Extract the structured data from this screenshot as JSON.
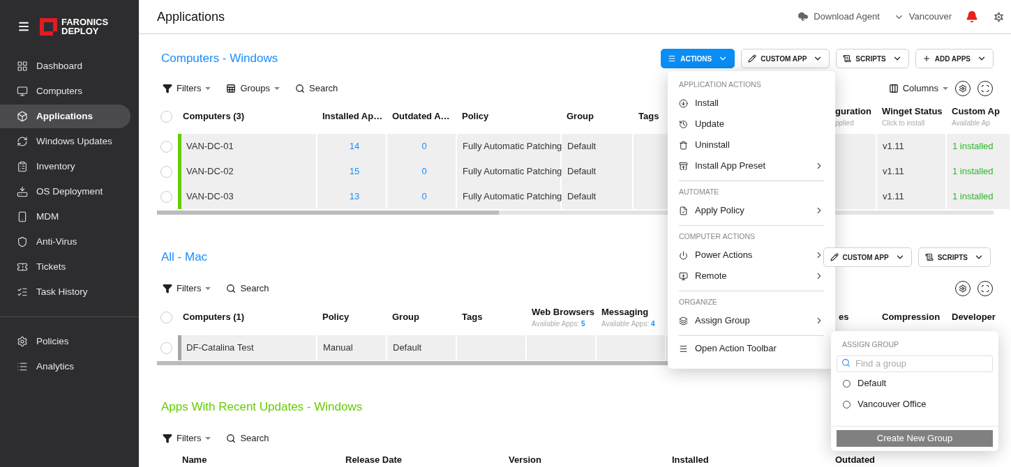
{
  "sidebar": {
    "brand": [
      "FARONICS",
      "DEPLOY"
    ],
    "items": [
      {
        "label": "Dashboard",
        "selected": false
      },
      {
        "label": "Computers",
        "selected": false
      },
      {
        "label": "Applications",
        "selected": true
      },
      {
        "label": "Windows Updates",
        "selected": false
      },
      {
        "label": "Inventory",
        "selected": false
      },
      {
        "label": "OS Deployment",
        "selected": false
      },
      {
        "label": "MDM",
        "selected": false
      },
      {
        "label": "Anti-Virus",
        "selected": false
      },
      {
        "label": "Tickets",
        "selected": false
      },
      {
        "label": "Task History",
        "selected": false
      }
    ],
    "secondary_items": [
      {
        "label": "Policies",
        "selected": false
      },
      {
        "label": "Analytics",
        "selected": false
      }
    ]
  },
  "header": {
    "title": "Applications",
    "download": "Download Agent",
    "location": "Vancouver"
  },
  "windows_section": {
    "title": "Computers - Windows",
    "buttons": [
      {
        "label": "ACTIONS",
        "selected": true
      },
      {
        "label": "CUSTOM APP",
        "selected": false
      },
      {
        "label": "SCRIPTS",
        "selected": false
      },
      {
        "label": "ADD APPS",
        "selected": false
      }
    ],
    "toolbar": {
      "filters": "Filters",
      "groups": "Groups",
      "search": "Search",
      "columns": "Columns"
    },
    "header_checked": false,
    "columns": [
      {
        "label": "Computers (3)"
      },
      {
        "label": "Installed Ap…"
      },
      {
        "label": "Outdated A…"
      },
      {
        "label": "Policy"
      },
      {
        "label": "Group"
      },
      {
        "label": "Tags"
      },
      {
        "label": "guration",
        "subtitle": "pplied"
      },
      {
        "label": "Winget Status",
        "subtitle": "Click to install"
      },
      {
        "label": "Custom Ap",
        "subtitle": "Available Ap"
      }
    ],
    "rows": [
      {
        "name": "VAN-DC-01",
        "color": "#66cc00",
        "checked": false,
        "installed": "14",
        "outdated": "0",
        "policy": "Fully Automatic Patching",
        "group": "Default",
        "winget": "v1.11",
        "custom": "1 installed"
      },
      {
        "name": "VAN-DC-02",
        "color": "#66cc00",
        "checked": false,
        "installed": "15",
        "outdated": "0",
        "policy": "Fully Automatic Patching",
        "group": "Default",
        "winget": "v1.11",
        "custom": "1 installed"
      },
      {
        "name": "VAN-DC-03",
        "color": "#66cc00",
        "checked": false,
        "installed": "13",
        "outdated": "0",
        "policy": "Fully Automatic Patching",
        "group": "Default",
        "winget": "v1.11",
        "custom": "1 installed"
      }
    ]
  },
  "mac_section": {
    "title": "All - Mac",
    "buttons": [
      {
        "label": "CUSTOM APP",
        "selected": false
      },
      {
        "label": "SCRIPTS",
        "selected": false
      }
    ],
    "toolbar": {
      "filters": "Filters",
      "search": "Search"
    },
    "header_checked": false,
    "columns": [
      {
        "label": "Computers (1)"
      },
      {
        "label": "Policy"
      },
      {
        "label": "Group"
      },
      {
        "label": "Tags"
      },
      {
        "label": "Web Browsers",
        "subtitle": "Available Apps:",
        "count": "5"
      },
      {
        "label": "Messaging",
        "subtitle": "Available Apps:",
        "count": "4"
      },
      {
        "label": "es"
      },
      {
        "label": "Compression"
      },
      {
        "label": "Developer"
      }
    ],
    "rows": [
      {
        "name": "DF-Catalina Test",
        "color": "#a6a6a6",
        "checked": false,
        "policy": "Manual",
        "group": "Default"
      }
    ]
  },
  "updates_section": {
    "title": "Apps With Recent Updates - Windows",
    "toolbar": {
      "filters": "Filters",
      "search": "Search"
    },
    "columns": [
      "Name",
      "Release Date",
      "Version",
      "Installed",
      "Outdated"
    ]
  },
  "actions_menu": {
    "sections": [
      {
        "heading": "APPLICATION ACTIONS",
        "items": [
          {
            "label": "Install",
            "has_submenu": false
          },
          {
            "label": "Update",
            "has_submenu": false
          },
          {
            "label": "Uninstall",
            "has_submenu": false
          },
          {
            "label": "Install App Preset",
            "has_submenu": true
          }
        ]
      },
      {
        "heading": "AUTOMATE",
        "items": [
          {
            "label": "Apply Policy",
            "has_submenu": true
          }
        ]
      },
      {
        "heading": "COMPUTER ACTIONS",
        "items": [
          {
            "label": "Power Actions",
            "has_submenu": true
          },
          {
            "label": "Remote",
            "has_submenu": true
          }
        ]
      },
      {
        "heading": "ORGANIZE",
        "items": [
          {
            "label": "Assign Group",
            "has_submenu": true
          }
        ]
      },
      {
        "items": [
          {
            "label": "Open Action Toolbar",
            "has_submenu": false
          }
        ]
      }
    ]
  },
  "assign_group": {
    "heading": "ASSIGN GROUP",
    "placeholder": "Find a group",
    "options": [
      {
        "label": "Default",
        "selected": false
      },
      {
        "label": "Vancouver Office",
        "selected": false
      }
    ],
    "button": "Create New Group"
  }
}
